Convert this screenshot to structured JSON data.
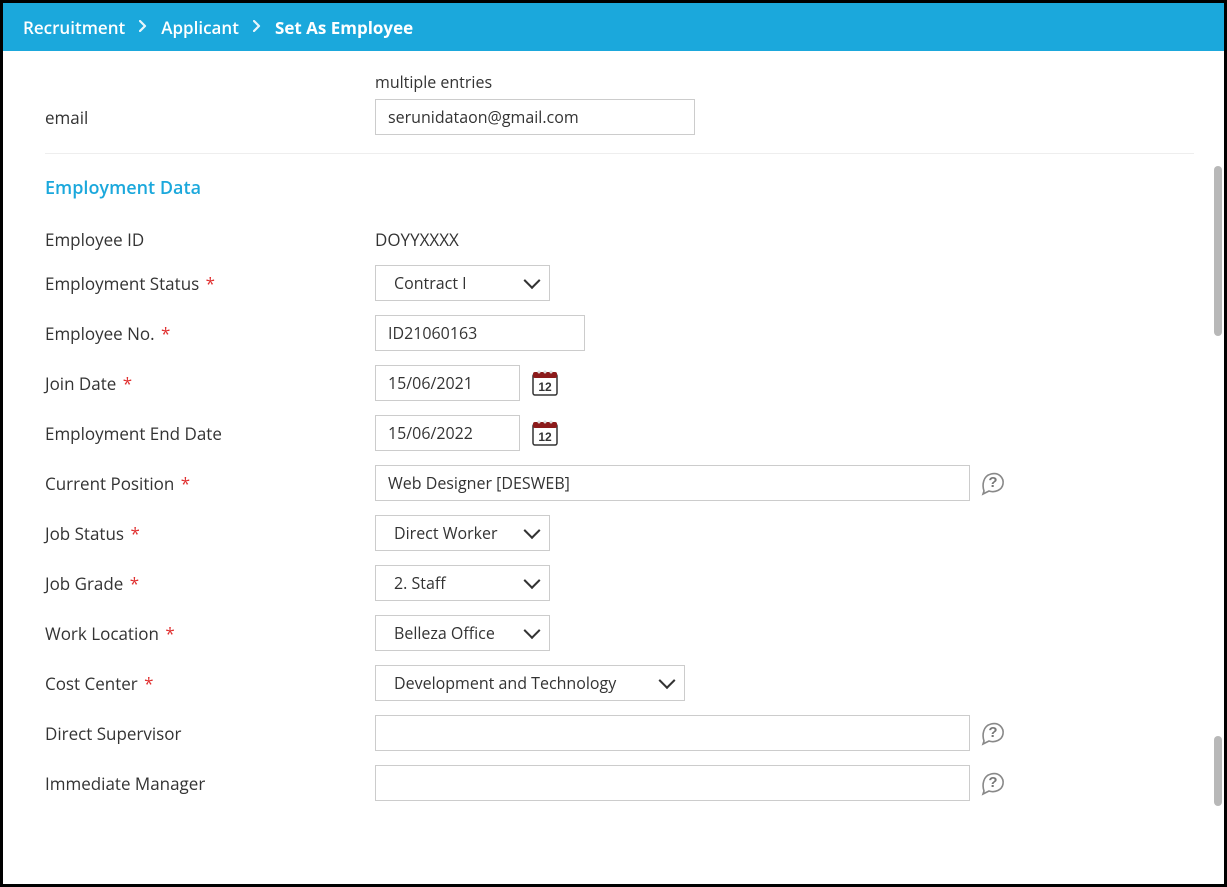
{
  "breadcrumb": {
    "items": [
      "Recruitment",
      "Applicant",
      "Set As Employee"
    ]
  },
  "email": {
    "hint": "multiple entries",
    "label": "email",
    "value": "serunidataon@gmail.com"
  },
  "section": {
    "title": "Employment Data"
  },
  "fields": {
    "employee_id": {
      "label": "Employee ID",
      "value": "DOYYXXXX"
    },
    "employment_status": {
      "label": "Employment Status",
      "value": "Contract I"
    },
    "employee_no": {
      "label": "Employee No.",
      "value": "ID21060163"
    },
    "join_date": {
      "label": "Join Date",
      "value": "15/06/2021"
    },
    "employment_end_date": {
      "label": "Employment End Date",
      "value": "15/06/2022"
    },
    "current_position": {
      "label": "Current Position",
      "value": "Web Designer [DESWEB]"
    },
    "job_status": {
      "label": "Job Status",
      "value": "Direct Worker"
    },
    "job_grade": {
      "label": "Job Grade",
      "value": "2. Staff"
    },
    "work_location": {
      "label": "Work Location",
      "value": "Belleza Office"
    },
    "cost_center": {
      "label": "Cost Center",
      "value": "Development and Technology"
    },
    "direct_supervisor": {
      "label": "Direct Supervisor",
      "value": ""
    },
    "immediate_manager": {
      "label": "Immediate Manager",
      "value": ""
    }
  },
  "required_marker": "*"
}
